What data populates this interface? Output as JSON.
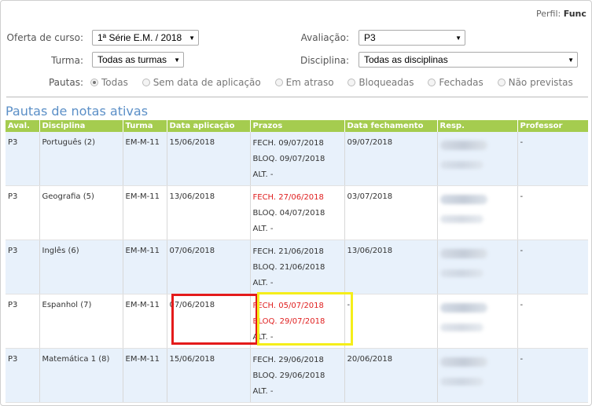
{
  "header": {
    "perfil_label": "Perfil:",
    "perfil_value": "Func"
  },
  "filters": {
    "oferta": {
      "label": "Oferta de curso:",
      "value": "1ª Série E.M. / 2018"
    },
    "turma": {
      "label": "Turma:",
      "value": "Todas as turmas"
    },
    "avaliacao": {
      "label": "Avaliação:",
      "value": "P3"
    },
    "disciplina": {
      "label": "Disciplina:",
      "value": "Todas as disciplinas"
    },
    "pautas": {
      "label": "Pautas:",
      "options": [
        "Todas",
        "Sem data de aplicação",
        "Em atraso",
        "Bloqueadas",
        "Fechadas",
        "Não previstas"
      ],
      "selected": "Todas"
    }
  },
  "section_title": "Pautas de notas ativas",
  "table": {
    "headers": [
      "Aval.",
      "Disciplina",
      "Turma",
      "Data aplicação",
      "Prazos",
      "Data fechamento",
      "Resp.",
      "Professor"
    ],
    "rows": [
      {
        "aval": "P3",
        "disciplina": "Português (2)",
        "turma": "EM-M-11",
        "data_aplicacao": "15/06/2018",
        "fech": "FECH.  09/07/2018",
        "bloq": "BLOQ. 09/07/2018",
        "alt": "ALT.   -",
        "fech_red": false,
        "bloq_red": false,
        "data_fechamento": "09/07/2018",
        "professor": "-"
      },
      {
        "aval": "P3",
        "disciplina": "Geografia (5)",
        "turma": "EM-M-11",
        "data_aplicacao": "13/06/2018",
        "fech": "FECH.  27/06/2018",
        "bloq": "BLOQ. 04/07/2018",
        "alt": "ALT.   -",
        "fech_red": true,
        "bloq_red": false,
        "data_fechamento": "03/07/2018",
        "professor": "-"
      },
      {
        "aval": "P3",
        "disciplina": "Inglês (6)",
        "turma": "EM-M-11",
        "data_aplicacao": "07/06/2018",
        "fech": "FECH.  21/06/2018",
        "bloq": "BLOQ. 21/06/2018",
        "alt": "ALT.   -",
        "fech_red": false,
        "bloq_red": false,
        "data_fechamento": "13/06/2018",
        "professor": "-"
      },
      {
        "aval": "P3",
        "disciplina": "Espanhol (7)",
        "turma": "EM-M-11",
        "data_aplicacao": "07/06/2018",
        "fech": "FECH.  05/07/2018",
        "bloq": "BLOQ. 29/07/2018",
        "alt": "ALT.   -",
        "fech_red": true,
        "bloq_red": true,
        "data_fechamento": "-",
        "professor": "-"
      },
      {
        "aval": "P3",
        "disciplina": "Matemática 1 (8)",
        "turma": "EM-M-11",
        "data_aplicacao": "15/06/2018",
        "fech": "FECH.  29/06/2018",
        "bloq": "BLOQ. 29/06/2018",
        "alt": "ALT.   -",
        "fech_red": false,
        "bloq_red": false,
        "data_fechamento": "20/06/2018",
        "professor": "-"
      }
    ]
  },
  "colors": {
    "accent": "#a5cc4f",
    "title": "#5b8fc7",
    "row_alt": "#e8f1fb",
    "highlight_red": "#e41b1b",
    "highlight_yellow": "#f5ee1a"
  }
}
